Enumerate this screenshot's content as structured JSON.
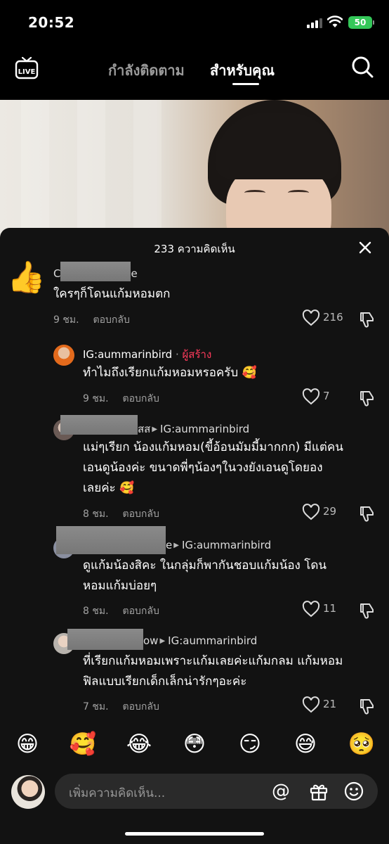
{
  "status_bar": {
    "time": "20:52",
    "battery": "50"
  },
  "top_nav": {
    "live_label": "LIVE",
    "tabs": [
      {
        "label": "กำลังติดตาม",
        "active": false
      },
      {
        "label": "สำหรับคุณ",
        "active": true
      }
    ],
    "search_icon": "search-icon"
  },
  "comments_panel": {
    "title": "233 ความคิดเห็น",
    "close_icon": "close-icon",
    "comments": [
      {
        "username_prefix": "C",
        "username_suffix": "e",
        "text": "ใครๆก็โดนแก้มหอมตก",
        "time": "9 ชม.",
        "reply_label": "ตอบกลับ",
        "likes": "216"
      },
      {
        "username": "IG:aummarinbird",
        "separator": "·",
        "creator_badge": "ผู้สร้าง",
        "text": "ทำไมถึงเรียกแก้มหอมหรอครับ 🥰",
        "time": "9 ชม.",
        "reply_label": "ตอบกลับ",
        "likes": "7"
      },
      {
        "username_suffix": "สส",
        "reply_to": "IG:aummarinbird",
        "text_lines": [
          "แม่ๆเรียก น้องแก้มหอม(ขี้อ้อนมัมมี้มากกก) มีแต่คน",
          "เอนดูน้องค่ะ ขนาดพี่ๆน้องๆในวงยังเอนดูโดยอง",
          "เลยค่ะ 🥰"
        ],
        "time": "8 ชม.",
        "reply_label": "ตอบกลับ",
        "likes": "29"
      },
      {
        "username_suffix": "e",
        "reply_to": "IG:aummarinbird",
        "text_lines": [
          "ดูแก้มน้องสิคะ ในกลุ่มก็พากันชอบแก้มน้อง โดน",
          "หอมแก้มบ่อยๆ"
        ],
        "time": "8 ชม.",
        "reply_label": "ตอบกลับ",
        "likes": "11"
      },
      {
        "username_suffix": "ow",
        "reply_to": "IG:aummarinbird",
        "text_lines": [
          "ที่เรียกแก้มหอมเพราะแก้มเลยค่ะแก้มกลม แก้มหอม",
          "ฟิลแบบเรียกเด็กเล็กน่ารักๆอะค่ะ"
        ],
        "time": "7 ชม.",
        "reply_label": "ตอบกลับ",
        "likes": "21"
      }
    ]
  },
  "emoji_bar": [
    "😁",
    "🥰",
    "😂",
    "😳",
    "😏",
    "😅",
    "🥺"
  ],
  "input": {
    "placeholder": "เพิ่มความคิดเห็น...",
    "mention_icon": "at-icon",
    "gift_icon": "gift-icon",
    "emoji_icon": "smile-icon"
  },
  "colors": {
    "creator": "#ff3b5c",
    "battery": "#34c759",
    "sheet": "#121212"
  }
}
